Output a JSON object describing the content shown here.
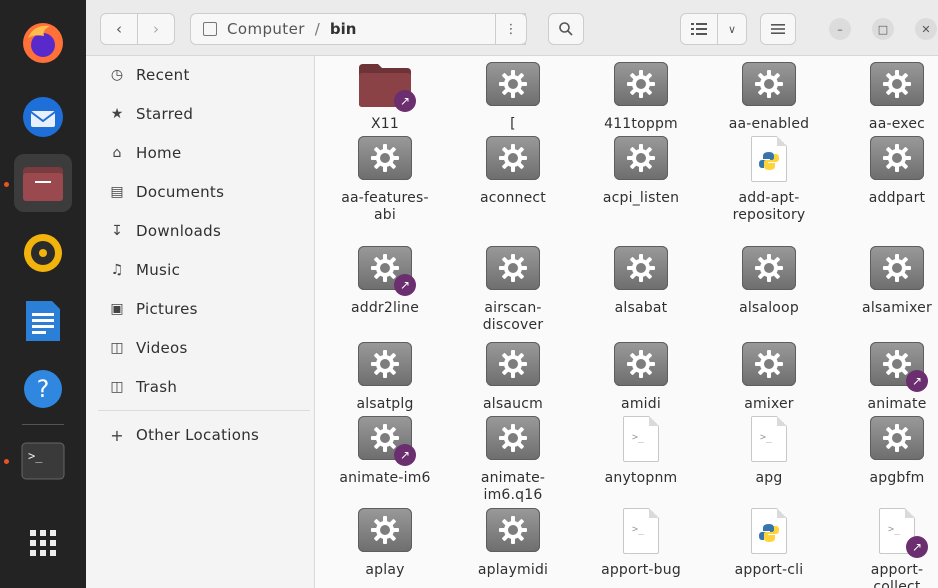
{
  "header": {
    "location_segments": [
      "Computer",
      "bin"
    ],
    "location_separator": "/",
    "back_icon": "chevron-left-icon",
    "forward_icon": "chevron-right-icon",
    "menu_icon": "vertical-ellipsis-icon",
    "search_icon": "search-icon"
  },
  "dock": {
    "apps": [
      "firefox-icon",
      "thunderbird-icon",
      "files-icon",
      "rhythmbox-icon",
      "libreoffice-writer-icon",
      "help-icon",
      "terminal-icon",
      "show-apps-icon"
    ]
  },
  "sidebar": {
    "items": [
      {
        "label": "Recent",
        "icon": "clock-icon"
      },
      {
        "label": "Starred",
        "icon": "star-icon"
      },
      {
        "label": "Home",
        "icon": "home-icon"
      },
      {
        "label": "Documents",
        "icon": "document-icon"
      },
      {
        "label": "Downloads",
        "icon": "download-icon"
      },
      {
        "label": "Music",
        "icon": "music-icon"
      },
      {
        "label": "Pictures",
        "icon": "picture-icon"
      },
      {
        "label": "Videos",
        "icon": "video-icon"
      },
      {
        "label": "Trash",
        "icon": "trash-icon"
      }
    ],
    "other_locations": {
      "label": "Other Locations",
      "icon": "plus-icon"
    }
  },
  "files": [
    {
      "name": "X11",
      "type": "folder",
      "link": true
    },
    {
      "name": "[",
      "type": "exec",
      "link": false
    },
    {
      "name": "411toppm",
      "type": "exec",
      "link": false
    },
    {
      "name": "aa-enabled",
      "type": "exec",
      "link": false
    },
    {
      "name": "aa-exec",
      "type": "exec",
      "link": false
    },
    {
      "name": "aa-features-abi",
      "type": "exec",
      "link": false
    },
    {
      "name": "aconnect",
      "type": "exec",
      "link": false
    },
    {
      "name": "acpi_listen",
      "type": "exec",
      "link": false
    },
    {
      "name": "add-apt-repository",
      "type": "python",
      "link": false
    },
    {
      "name": "addpart",
      "type": "exec",
      "link": false
    },
    {
      "name": "addr2line",
      "type": "exec",
      "link": true
    },
    {
      "name": "airscan-discover",
      "type": "exec",
      "link": false
    },
    {
      "name": "alsabat",
      "type": "exec",
      "link": false
    },
    {
      "name": "alsaloop",
      "type": "exec",
      "link": false
    },
    {
      "name": "alsamixer",
      "type": "exec",
      "link": false
    },
    {
      "name": "alsatplg",
      "type": "exec",
      "link": false
    },
    {
      "name": "alsaucm",
      "type": "exec",
      "link": false
    },
    {
      "name": "amidi",
      "type": "exec",
      "link": false
    },
    {
      "name": "amixer",
      "type": "exec",
      "link": false
    },
    {
      "name": "animate",
      "type": "exec",
      "link": true
    },
    {
      "name": "animate-im6",
      "type": "exec",
      "link": true
    },
    {
      "name": "animate-im6.q16",
      "type": "exec",
      "link": false
    },
    {
      "name": "anytopnm",
      "type": "script",
      "link": false
    },
    {
      "name": "apg",
      "type": "script",
      "link": false
    },
    {
      "name": "apgbfm",
      "type": "exec",
      "link": false
    },
    {
      "name": "aplay",
      "type": "exec",
      "link": false
    },
    {
      "name": "aplaymidi",
      "type": "exec",
      "link": false
    },
    {
      "name": "apport-bug",
      "type": "script",
      "link": false
    },
    {
      "name": "apport-cli",
      "type": "python",
      "link": false
    },
    {
      "name": "apport-collect",
      "type": "script",
      "link": true
    }
  ],
  "colors": {
    "accent": "#e95420",
    "link_badge": "#6b2e6f",
    "folder": "#7a3b3f"
  }
}
